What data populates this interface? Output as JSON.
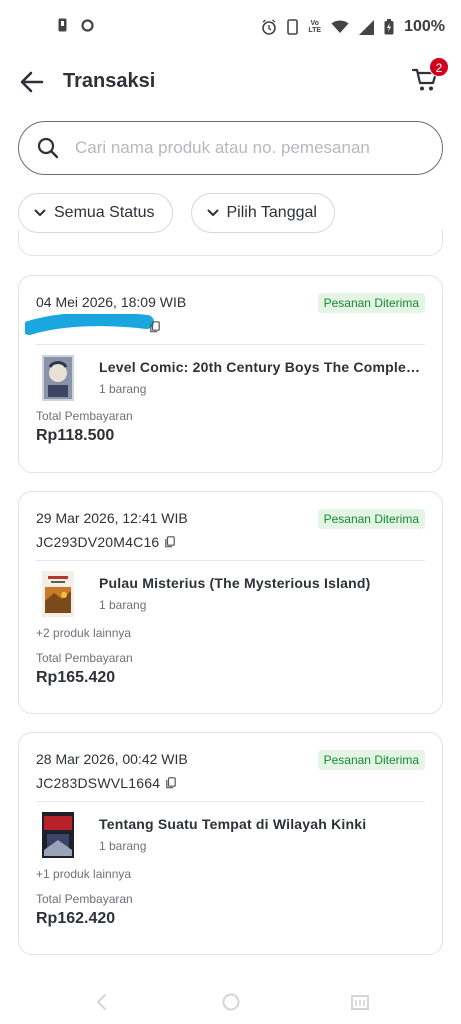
{
  "status_bar": {
    "left_icons": [
      "sim-icon",
      "circle-icon"
    ],
    "right_icons": [
      "alarm-icon",
      "phone-icon",
      "volte-icon",
      "wifi-icon",
      "signal-icon",
      "battery-icon"
    ],
    "volte_top": "Vo",
    "volte_bottom": "LTE",
    "battery": "100%"
  },
  "header": {
    "title": "Transaksi",
    "cart_badge": "2"
  },
  "search": {
    "placeholder": "Cari nama produk atau no. pemesanan",
    "value": ""
  },
  "filters": [
    {
      "label": "Semua Status"
    },
    {
      "label": "Pilih Tanggal"
    }
  ],
  "orders": [
    {
      "date": "04 Mei 2026, 18:09 WIB",
      "status": "Pesanan Diterima",
      "order_id": "",
      "product": "Level Comic: 20th Century Boys The Complete E...",
      "qty": "1 barang",
      "more": "",
      "total_label": "Total Pembayaran",
      "total": "Rp118.500"
    },
    {
      "date": "29 Mar 2026, 12:41 WIB",
      "status": "Pesanan Diterima",
      "order_id": "JC293DV20M4C16",
      "product": "Pulau Misterius (The Mysterious Island)",
      "qty": "1 barang",
      "more": "+2 produk lainnya",
      "total_label": "Total Pembayaran",
      "total": "Rp165.420"
    },
    {
      "date": "28 Mar 2026, 00:42 WIB",
      "status": "Pesanan Diterima",
      "order_id": "JC283DSWVL1664",
      "product": "Tentang Suatu Tempat di Wilayah Kinki",
      "qty": "1 barang",
      "more": "+1 produk lainnya",
      "total_label": "Total Pembayaran",
      "total": "Rp162.420"
    }
  ],
  "colors": {
    "status_badge_bg": "#e4f5e6",
    "status_badge_text": "#138a2c",
    "cart_badge": "#d0021b",
    "redaction": "#1aa7e0"
  },
  "nav_bar": [
    "back-nav-icon",
    "home-nav-icon",
    "recents-nav-icon"
  ]
}
